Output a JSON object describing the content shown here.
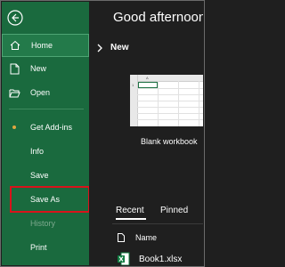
{
  "nav": {
    "back_label": "Back",
    "items": [
      {
        "label": "Home",
        "icon": "home-icon",
        "selected": true
      },
      {
        "label": "New",
        "icon": "new-document-icon"
      },
      {
        "label": "Open",
        "icon": "folder-open-icon"
      },
      {
        "label": "Get Add-ins",
        "icon": "dot-indicator"
      },
      {
        "label": "Info"
      },
      {
        "label": "Save"
      },
      {
        "label": "Save As",
        "highlighted": true
      },
      {
        "label": "History",
        "disabled": true
      },
      {
        "label": "Print"
      }
    ]
  },
  "main": {
    "greeting": "Good afternoon",
    "new_section_label": "New",
    "blank_workbook_label": "Blank workbook",
    "thumbnail": {
      "cell_ref_col": "A",
      "cell_ref_row": "1"
    },
    "tabs": [
      "Recent",
      "Pinned"
    ],
    "list_header_name": "Name",
    "recent_files": [
      {
        "name": "Book1.xlsx",
        "icon": "excel-file-icon"
      }
    ]
  },
  "colors": {
    "nav_green": "#1a6a3e",
    "selected_green": "#237a4a",
    "highlight_red": "#d8131b",
    "content_bg": "#1f1f1f",
    "addins_dot": "#e0a640"
  }
}
